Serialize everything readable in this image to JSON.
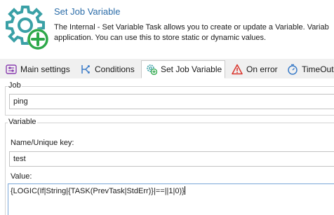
{
  "header": {
    "title": "Set Job Variable",
    "description": "The Internal - Set Variable Task allows you to create or update a Variable. Variab\napplication. You can use this to store static or dynamic values.",
    "icon": "gear-plus-icon"
  },
  "tabs": [
    {
      "label": "Main settings",
      "icon": "sliders-icon"
    },
    {
      "label": "Conditions",
      "icon": "conditions-icon"
    },
    {
      "label": "Set Job Variable",
      "icon": "gear-plus-icon",
      "active": true
    },
    {
      "label": "On error",
      "icon": "warning-icon"
    },
    {
      "label": "TimeOut",
      "icon": "stopwatch-icon"
    }
  ],
  "job_group": {
    "caption": "Job",
    "value": "ping"
  },
  "variable_group": {
    "caption": "Variable",
    "name_label": "Name/Unique key:",
    "name_value": "test",
    "value_label": "Value:",
    "value_text": "{LOGIC(If|String|{TASK(PrevTask|StdErr)}|==||1|0)}"
  },
  "colors": {
    "accent": "#2b6ca8",
    "icon_teal": "#3aa0a6",
    "icon_green": "#2ea84a",
    "warning_red": "#d9332b"
  }
}
